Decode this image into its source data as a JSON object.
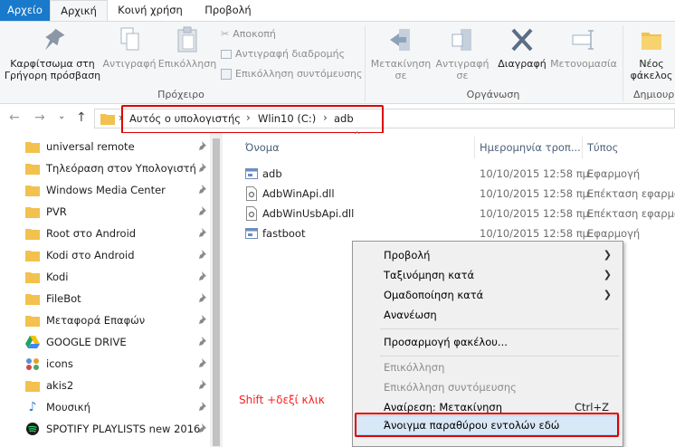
{
  "ribbon_tabs": {
    "file": "Αρχείο",
    "home": "Αρχική",
    "share": "Κοινή χρήση",
    "view": "Προβολή"
  },
  "clipboard": {
    "pin_line1": "Καρφίτσωμα στη",
    "pin_line2": "Γρήγορη πρόσβαση",
    "copy": "Αντιγραφή",
    "paste": "Επικόλληση",
    "cut": "Αποκοπή",
    "copy_path": "Αντιγραφή διαδρομής",
    "paste_shortcut": "Επικόλληση συντόμευσης",
    "group_label": "Πρόχειρο"
  },
  "organize": {
    "move_line1": "Μετακίνηση",
    "move_line2": "σε",
    "copy_line1": "Αντιγραφή",
    "copy_line2": "σε",
    "delete": "Διαγραφή",
    "rename": "Μετονομασία",
    "group_label": "Οργάνωση"
  },
  "new_group": {
    "folder_line1": "Νέος",
    "folder_line2": "φάκελος",
    "group_label": "Δημιουρ"
  },
  "address": {
    "part1": "Αυτός ο υπολογιστής",
    "part2": "Wlin10 (C:)",
    "part3": "adb"
  },
  "nav_items": [
    {
      "label": "universal remote"
    },
    {
      "label": "Τηλεόραση στον Υπολογιστή"
    },
    {
      "label": "Windows Media Center"
    },
    {
      "label": "PVR"
    },
    {
      "label": "Root στο Android"
    },
    {
      "label": "Kodi στο Android"
    },
    {
      "label": "Kodi"
    },
    {
      "label": "FileBot"
    },
    {
      "label": "Μεταφορά Επαφών"
    },
    {
      "label": "GOOGLE DRIVE"
    },
    {
      "label": "icons"
    },
    {
      "label": "akis2"
    },
    {
      "label": "Μουσική"
    },
    {
      "label": "SPOTIFY PLAYLISTS new 2016"
    }
  ],
  "columns": {
    "name": "Όνομα",
    "date": "Ημερομηνία τροπ...",
    "type": "Τύπος"
  },
  "files": [
    {
      "name": "adb",
      "date": "10/10/2015 12:58 πμ",
      "type": "Εφαρμογή"
    },
    {
      "name": "AdbWinApi.dll",
      "date": "10/10/2015 12:58 πμ",
      "type": "Επέκταση εφαρμο"
    },
    {
      "name": "AdbWinUsbApi.dll",
      "date": "10/10/2015 12:58 πμ",
      "type": "Επέκταση εφαρμο"
    },
    {
      "name": "fastboot",
      "date": "10/10/2015 12:58 πμ",
      "type": "Εφαρμογή"
    }
  ],
  "annotation": "Shift +δεξί κλικ",
  "context_menu": {
    "view": "Προβολή",
    "sort": "Ταξινόμηση κατά",
    "group": "Ομαδοποίηση κατά",
    "refresh": "Ανανέωση",
    "customize": "Προσαρμογή φακέλου...",
    "paste": "Επικόλληση",
    "paste_shortcut": "Επικόλληση συντόμευσης",
    "undo": "Αναίρεση: Μετακίνηση",
    "undo_shortcut": "Ctrl+Z",
    "open_cmd": "Άνοιγμα παραθύρου εντολών εδώ"
  },
  "colors": {
    "file_tab": "#1979ca",
    "highlight_frame": "#e00000",
    "annotation": "#ff1e1e",
    "folder": "#f2c14e"
  }
}
